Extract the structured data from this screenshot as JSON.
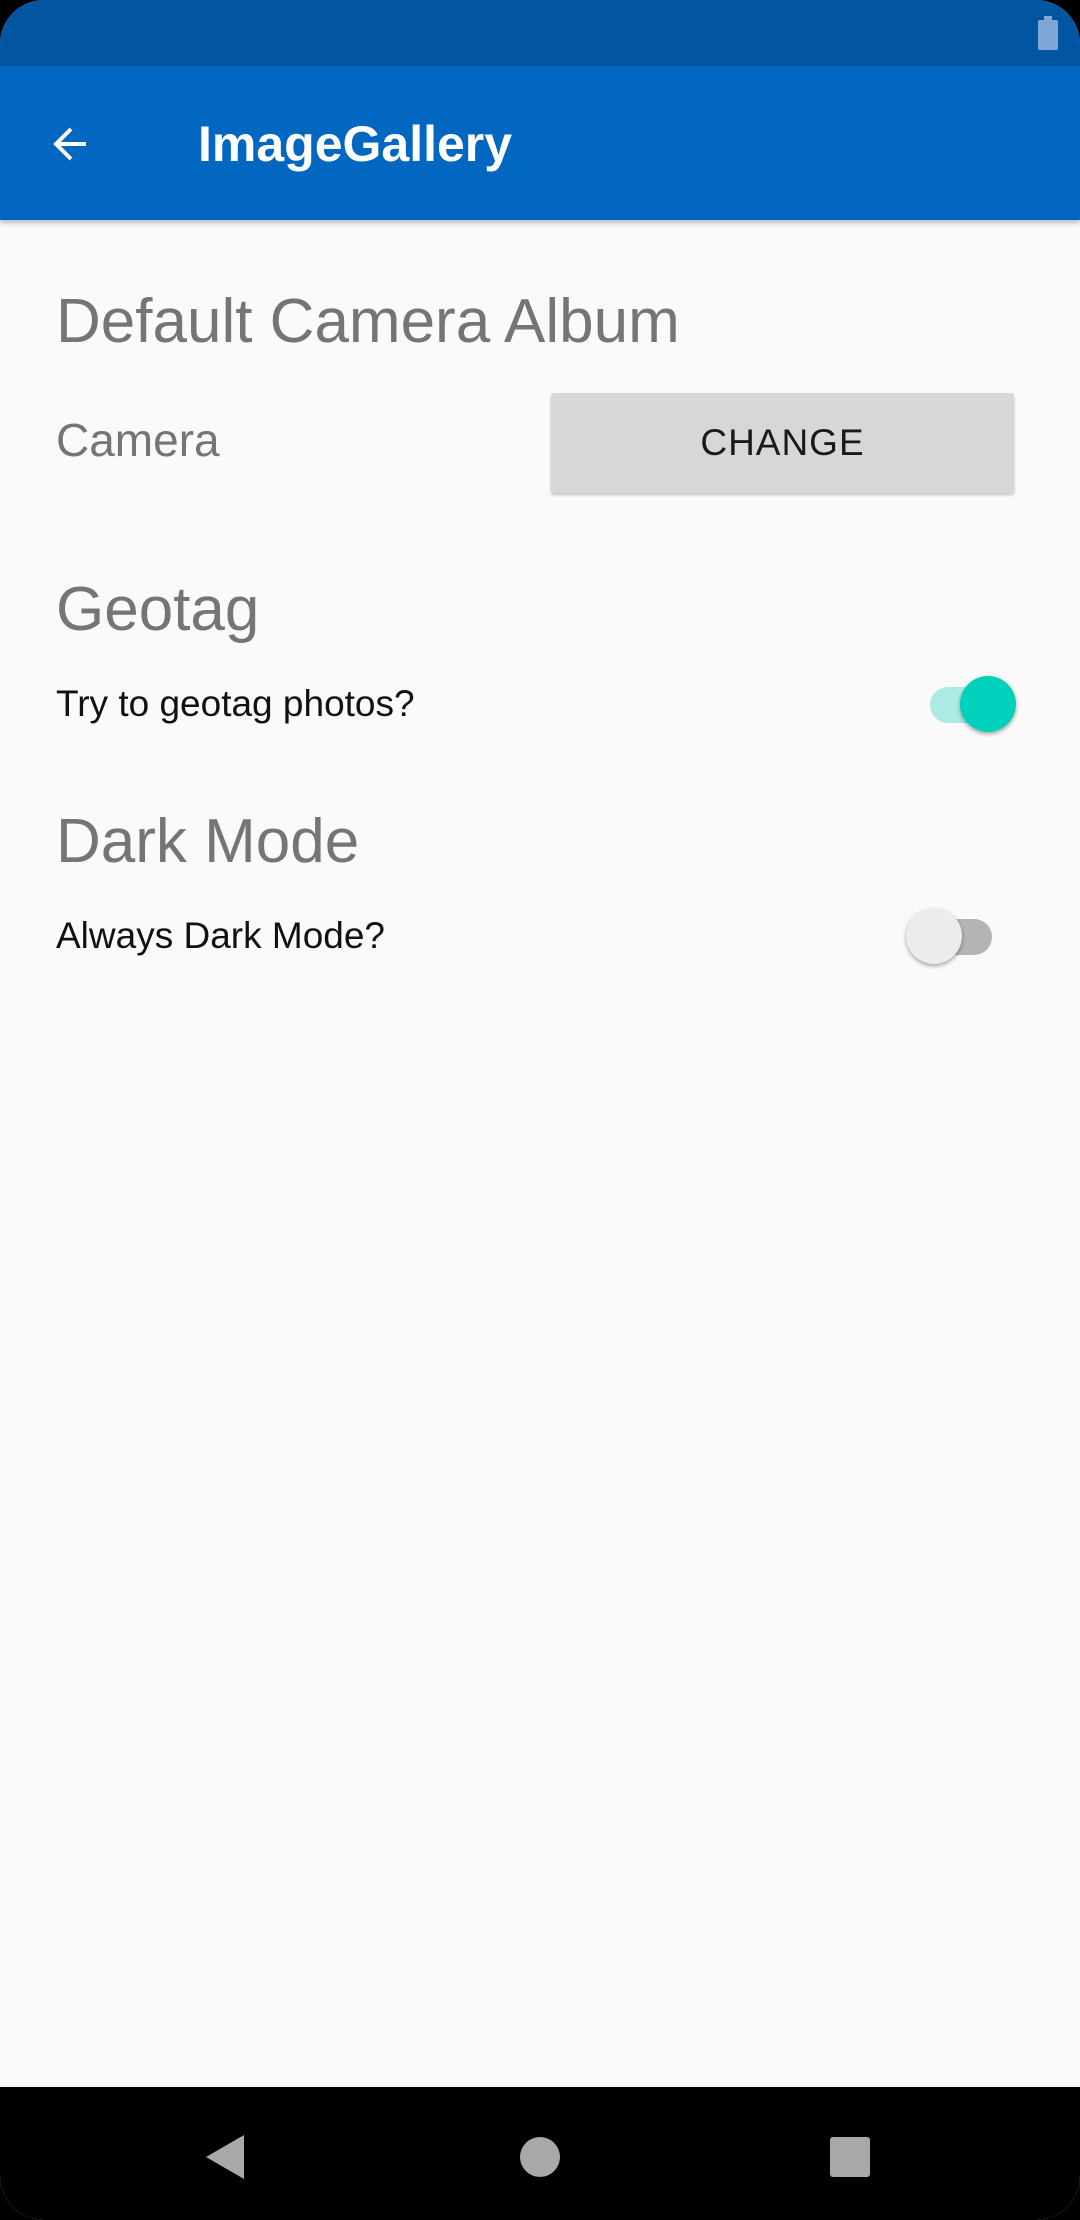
{
  "app": {
    "title": "ImageGallery"
  },
  "icons": {
    "status_battery": "battery-icon",
    "back": "arrow-back-icon",
    "nav_back": "triangle-back-icon",
    "nav_home": "circle-home-icon",
    "nav_recents": "square-recents-icon"
  },
  "colors": {
    "status_bar": "#0155a1",
    "app_bar": "#0167c0",
    "switch_on": "#00d1bc",
    "background": "#fafafa"
  },
  "sections": {
    "camera_album": {
      "title": "Default Camera Album",
      "value": "Camera",
      "button_label": "CHANGE"
    },
    "geotag": {
      "title": "Geotag",
      "label": "Try to geotag photos?",
      "checked": true
    },
    "dark_mode": {
      "title": "Dark Mode",
      "label": "Always Dark Mode?",
      "checked": false
    }
  }
}
